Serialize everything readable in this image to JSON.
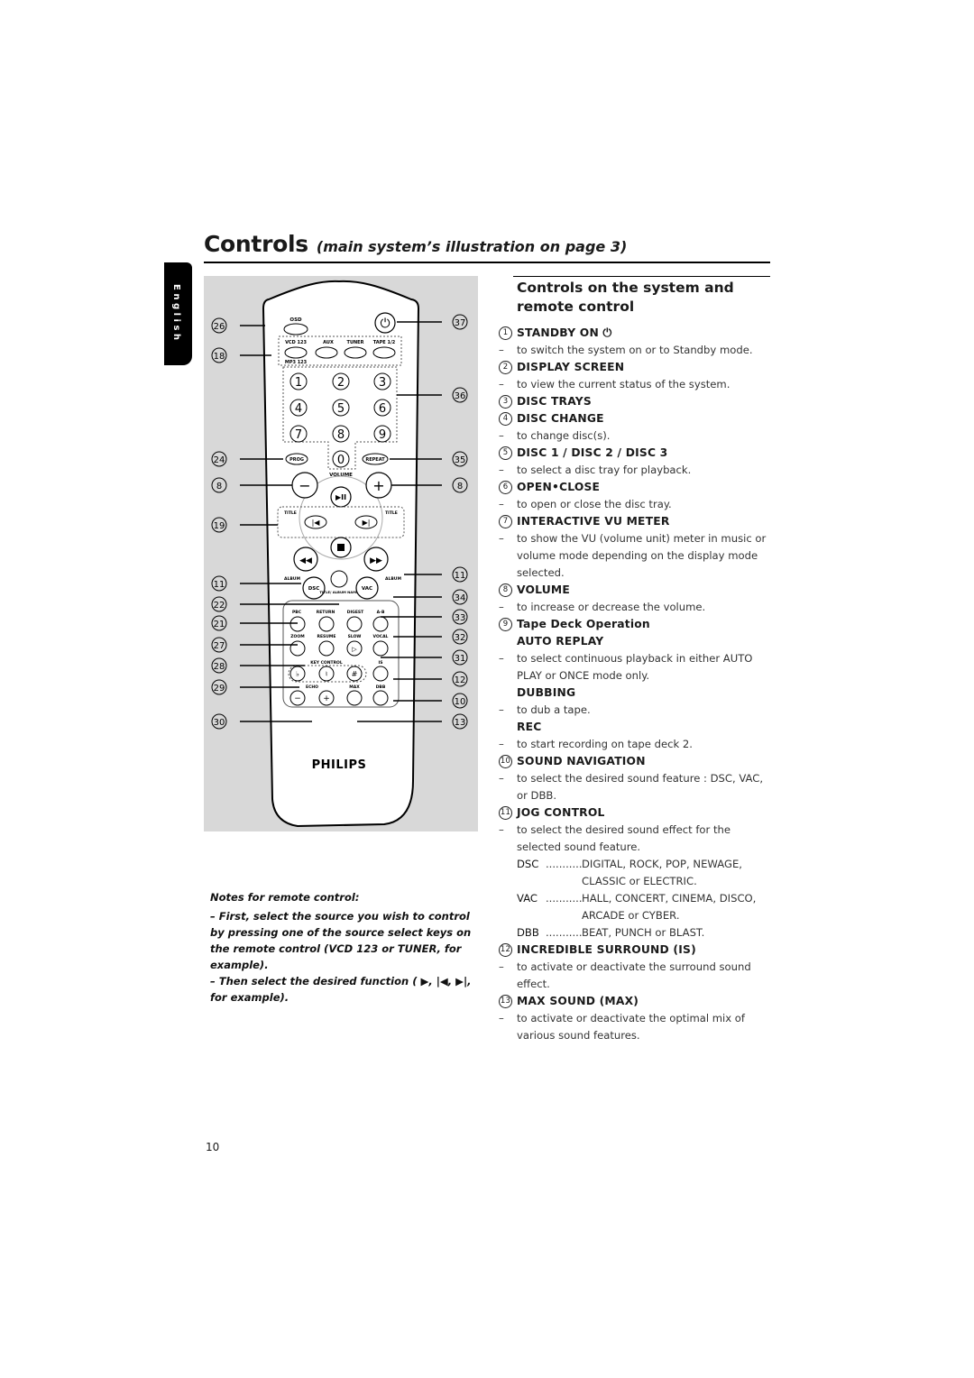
{
  "header": {
    "title": "Controls",
    "subtitle": "(main system’s illustration on page 3)"
  },
  "language_tab": "English",
  "remote": {
    "brand": "PHILIPS",
    "buttons": {
      "osd": "OSD",
      "vcd": "VCD 123",
      "mp3": "MP3 123",
      "aux": "AUX",
      "tuner": "TUNER",
      "tape": "TAPE 1/2",
      "digits": [
        "1",
        "2",
        "3",
        "4",
        "5",
        "6",
        "7",
        "8",
        "9",
        "0"
      ],
      "prog": "PROG",
      "repeat": "REPEAT",
      "volume": "VOLUME",
      "title_minus": "TITLE",
      "title_plus": "TITLE",
      "album_minus": "ALBUM",
      "album_plus": "ALBUM",
      "dsc": "DSC",
      "vac": "VAC",
      "title_album_name": "TITLE/ ALBUM NAME",
      "pbc": "PBC",
      "return": "RETURN",
      "digest": "DIGEST",
      "ab": "A-B",
      "zoom": "ZOOM",
      "resume": "RESUME",
      "slow": "SLOW",
      "vocal": "VOCAL",
      "key_control": "KEY CONTROL",
      "is": "IS",
      "echo": "ECHO",
      "max": "MAX",
      "dbb": "DBB"
    },
    "callouts_left": [
      "26",
      "18",
      "24",
      "8",
      "19",
      "11",
      "22",
      "21",
      "27",
      "28",
      "29",
      "30"
    ],
    "callouts_right": [
      "37",
      "36",
      "35",
      "8",
      "11",
      "34",
      "33",
      "32",
      "31",
      "12",
      "10",
      "13"
    ]
  },
  "section": {
    "title": "Controls on the system and remote control",
    "items": [
      {
        "num": "1",
        "heading": "STANDBY ON ⏻",
        "desc": [
          "to switch the system on or to Standby mode."
        ]
      },
      {
        "num": "2",
        "heading": "DISPLAY SCREEN",
        "desc": [
          "to view the current status of the system."
        ]
      },
      {
        "num": "3",
        "heading": "DISC TRAYS",
        "desc": []
      },
      {
        "num": "4",
        "heading": "DISC CHANGE",
        "desc": [
          "to change disc(s)."
        ]
      },
      {
        "num": "5",
        "heading": "DISC 1 / DISC 2 / DISC 3",
        "desc": [
          "to select a disc tray for playback."
        ]
      },
      {
        "num": "6",
        "heading": "OPEN•CLOSE",
        "desc": [
          "to open or close the disc tray."
        ]
      },
      {
        "num": "7",
        "heading": "INTERACTIVE VU METER",
        "desc": [
          "to show the VU (volume unit) meter in music or volume mode depending on the display mode selected."
        ]
      },
      {
        "num": "8",
        "heading": "VOLUME",
        "desc": [
          "to increase or decrease the volume."
        ]
      },
      {
        "num": "9",
        "heading": "Tape Deck Operation",
        "sub": [
          {
            "heading": "AUTO REPLAY",
            "desc": "to select continuous playback in either AUTO PLAY or ONCE mode only."
          },
          {
            "heading": "DUBBING",
            "desc": "to dub a tape."
          },
          {
            "heading": "REC",
            "desc": "to start recording on tape deck 2."
          }
        ]
      },
      {
        "num": "10",
        "heading": "SOUND NAVIGATION",
        "desc": [
          "to select the desired sound feature : DSC, VAC, or DBB."
        ]
      },
      {
        "num": "11",
        "heading": "JOG CONTROL",
        "desc": [
          "to select the desired sound effect for the selected sound feature."
        ],
        "defs": [
          {
            "key": "DSC",
            "value": "DIGITAL, ROCK, POP, NEWAGE, CLASSIC or ELECTRIC."
          },
          {
            "key": "VAC",
            "value": "HALL, CONCERT, CINEMA, DISCO, ARCADE or CYBER."
          },
          {
            "key": "DBB",
            "value": "BEAT, PUNCH or BLAST."
          }
        ]
      },
      {
        "num": "12",
        "heading": "INCREDIBLE SURROUND (IS)",
        "desc": [
          "to activate or deactivate the surround sound effect."
        ]
      },
      {
        "num": "13",
        "heading": "MAX SOUND (MAX)",
        "desc": [
          "to activate or deactivate the optimal mix of various sound features."
        ]
      }
    ]
  },
  "notes": {
    "title": "Notes for remote control:",
    "lines": [
      "– First, select the source you wish to control by pressing one of the source select keys on the remote control (VCD 123 or TUNER, for example).",
      "– Then select the desired function ( ▶, |◀, ▶|, for example)."
    ]
  },
  "page_number": "10"
}
